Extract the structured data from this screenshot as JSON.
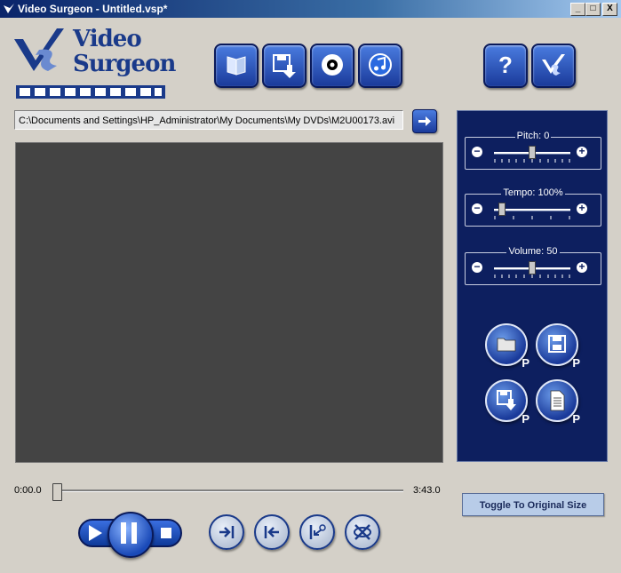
{
  "window": {
    "title": "Video Surgeon - Untitled.vsp*",
    "controls": [
      "_",
      "□",
      "X"
    ]
  },
  "logo": {
    "line1": "Video",
    "line2": "Surgeon"
  },
  "toolbar": {
    "buttons": [
      {
        "name": "open-project",
        "icon": "book-icon"
      },
      {
        "name": "save-export",
        "icon": "floppy-download-icon"
      },
      {
        "name": "dvd",
        "icon": "disc-icon"
      },
      {
        "name": "audio",
        "icon": "music-note-icon"
      },
      {
        "name": "help",
        "icon": "question-icon"
      },
      {
        "name": "surgeon",
        "icon": "scalpel-icon"
      }
    ]
  },
  "path": {
    "value": "C:\\Documents and Settings\\HP_Administrator\\My Documents\\My DVDs\\M2U00173.avi"
  },
  "controls": {
    "pitch": {
      "label": "Pitch: 0",
      "value": 0,
      "level": 0.5
    },
    "tempo": {
      "label": "Tempo: 100%",
      "value": 100,
      "level": 0.1
    },
    "volume": {
      "label": "Volume: 50",
      "value": 50,
      "level": 0.5
    }
  },
  "project_buttons": [
    {
      "icon": "folder-icon",
      "tag": "P"
    },
    {
      "icon": "floppy-icon",
      "tag": "P"
    },
    {
      "icon": "floppy-download-icon",
      "tag": "P"
    },
    {
      "icon": "document-icon",
      "tag": "P"
    }
  ],
  "playback": {
    "start_time": "0:00.0",
    "end_time": "3:43.0",
    "position_fraction": 0.0
  },
  "toggle_label": "Toggle To Original Size",
  "colors": {
    "accent": "#1a3a9a",
    "panel": "#0d1f5f",
    "window": "#d4d0c8"
  }
}
